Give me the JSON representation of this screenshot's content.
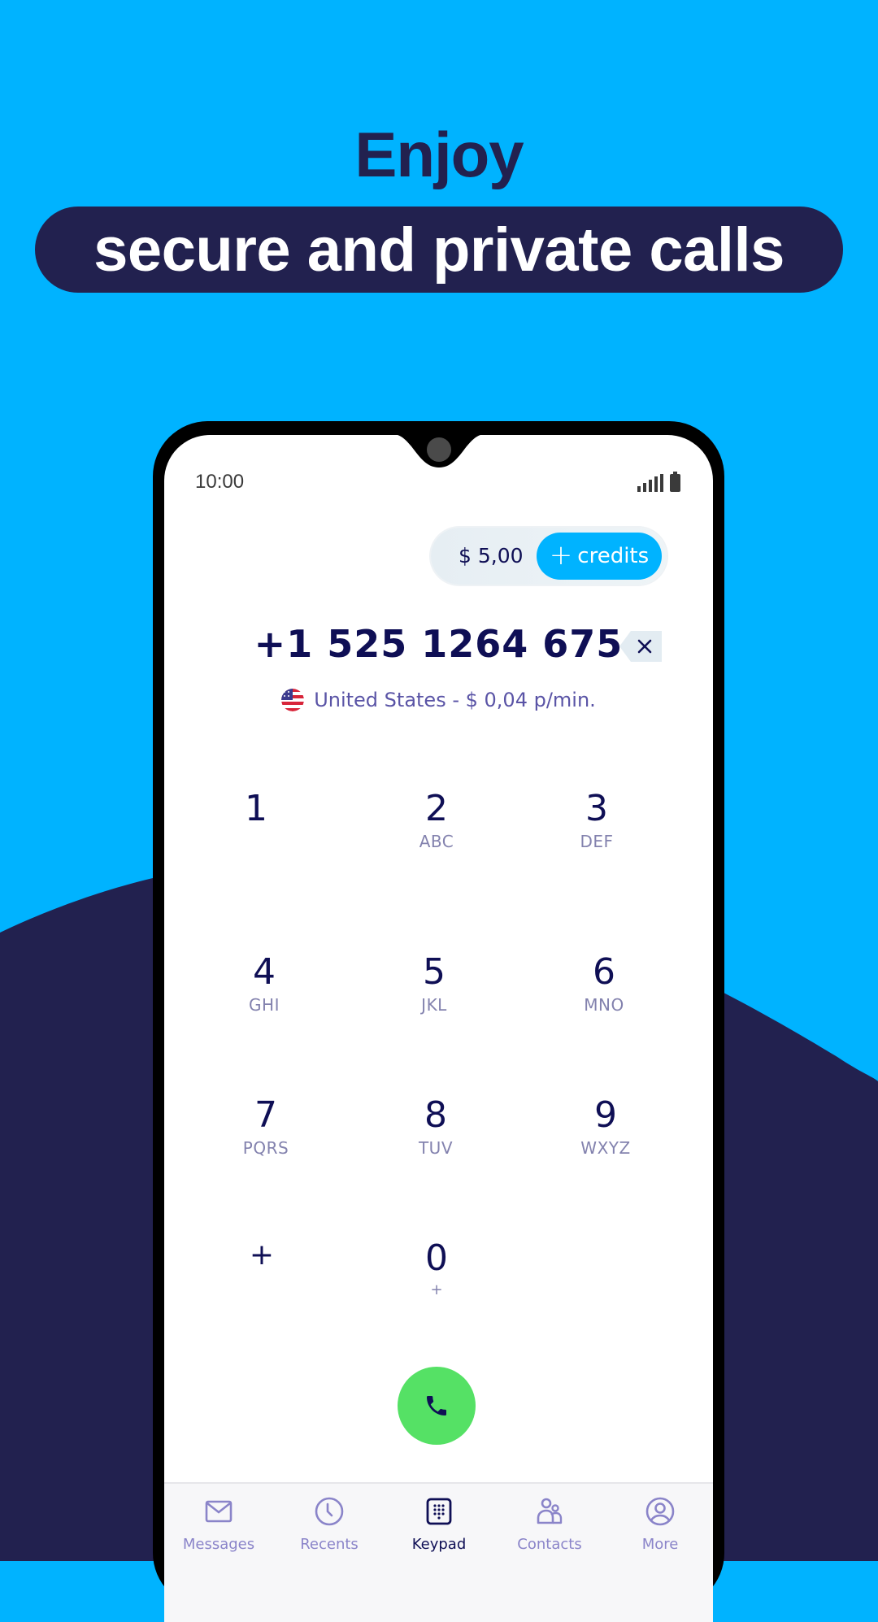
{
  "headline": {
    "title": "Enjoy",
    "banner": "secure and private calls"
  },
  "colors": {
    "background": "#00B3FF",
    "navy": "#22214F",
    "accent": "#00B3FF",
    "call_green": "#55E165",
    "text_primary": "#0F0F55",
    "text_secondary": "#8382AE",
    "nav_inactive": "#8A84C9"
  },
  "status_bar": {
    "time": "10:00",
    "signal_icon": "signal-icon",
    "battery_icon": "battery-icon"
  },
  "credits": {
    "balance": "$ 5,00",
    "button_icon": "plus-icon",
    "button_label": "credits"
  },
  "dialer": {
    "number": "+1 525 1264 675",
    "backspace_icon": "backspace-icon",
    "country_flag": "us-flag-icon",
    "rate_text": "United States - $ 0,04 p/min."
  },
  "keypad": {
    "keys": [
      {
        "digit": "1",
        "letters": ""
      },
      {
        "digit": "2",
        "letters": "ABC"
      },
      {
        "digit": "3",
        "letters": "DEF"
      },
      {
        "digit": "4",
        "letters": "GHI"
      },
      {
        "digit": "5",
        "letters": "JKL"
      },
      {
        "digit": "6",
        "letters": "MNO"
      },
      {
        "digit": "7",
        "letters": "PQRS"
      },
      {
        "digit": "8",
        "letters": "TUV"
      },
      {
        "digit": "9",
        "letters": "WXYZ"
      },
      {
        "digit": "+",
        "letters": ""
      },
      {
        "digit": "0",
        "letters": "+"
      }
    ]
  },
  "call_button": {
    "icon": "phone-icon"
  },
  "bottom_nav": {
    "items": [
      {
        "label": "Messages",
        "icon": "mail-icon",
        "active": false
      },
      {
        "label": "Recents",
        "icon": "clock-icon",
        "active": false
      },
      {
        "label": "Keypad",
        "icon": "keypad-icon",
        "active": true
      },
      {
        "label": "Contacts",
        "icon": "contacts-icon",
        "active": false
      },
      {
        "label": "More",
        "icon": "user-circle-icon",
        "active": false
      }
    ]
  }
}
